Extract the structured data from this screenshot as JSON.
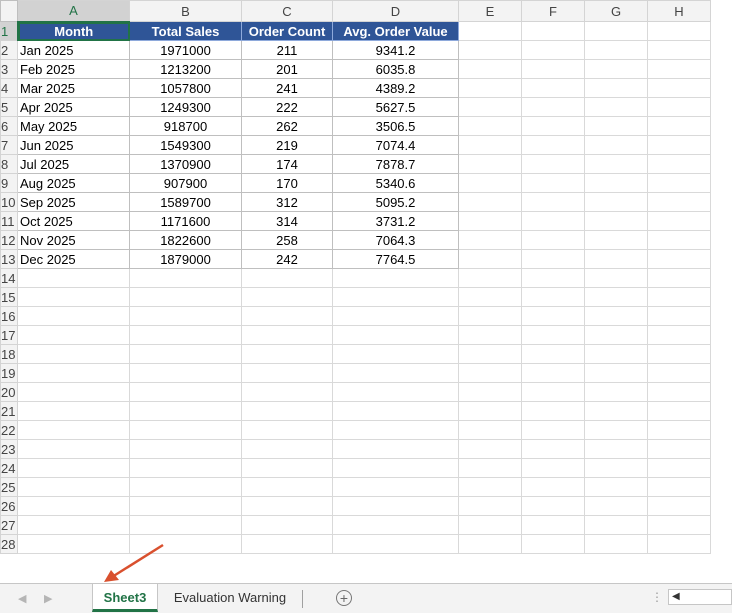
{
  "columns": [
    "A",
    "B",
    "C",
    "D",
    "E",
    "F",
    "G",
    "H"
  ],
  "header_row": {
    "month": "Month",
    "total_sales": "Total Sales",
    "order_count": "Order Count",
    "avg_order_value": "Avg. Order Value"
  },
  "rows": [
    {
      "month": "Jan 2025",
      "total_sales": "1971000",
      "order_count": "211",
      "avg": "9341.2"
    },
    {
      "month": "Feb 2025",
      "total_sales": "1213200",
      "order_count": "201",
      "avg": "6035.8"
    },
    {
      "month": "Mar 2025",
      "total_sales": "1057800",
      "order_count": "241",
      "avg": "4389.2"
    },
    {
      "month": "Apr 2025",
      "total_sales": "1249300",
      "order_count": "222",
      "avg": "5627.5"
    },
    {
      "month": "May 2025",
      "total_sales": "918700",
      "order_count": "262",
      "avg": "3506.5"
    },
    {
      "month": "Jun 2025",
      "total_sales": "1549300",
      "order_count": "219",
      "avg": "7074.4"
    },
    {
      "month": "Jul 2025",
      "total_sales": "1370900",
      "order_count": "174",
      "avg": "7878.7"
    },
    {
      "month": "Aug 2025",
      "total_sales": "907900",
      "order_count": "170",
      "avg": "5340.6"
    },
    {
      "month": "Sep 2025",
      "total_sales": "1589700",
      "order_count": "312",
      "avg": "5095.2"
    },
    {
      "month": "Oct 2025",
      "total_sales": "1171600",
      "order_count": "314",
      "avg": "3731.2"
    },
    {
      "month": "Nov 2025",
      "total_sales": "1822600",
      "order_count": "258",
      "avg": "7064.3"
    },
    {
      "month": "Dec 2025",
      "total_sales": "1879000",
      "order_count": "242",
      "avg": "7764.5"
    }
  ],
  "row_numbers": [
    "1",
    "2",
    "3",
    "4",
    "5",
    "6",
    "7",
    "8",
    "9",
    "10",
    "11",
    "12",
    "13",
    "14",
    "15",
    "16",
    "17",
    "18",
    "19",
    "20",
    "21",
    "22",
    "23",
    "24",
    "25",
    "26",
    "27",
    "28"
  ],
  "tabs": {
    "active": "Sheet3",
    "other": "Evaluation Warning",
    "add_icon": "plus-circle-icon"
  },
  "colors": {
    "header_fill": "#2f5597",
    "excel_green": "#217346",
    "annotation_arrow": "#d9502e"
  }
}
